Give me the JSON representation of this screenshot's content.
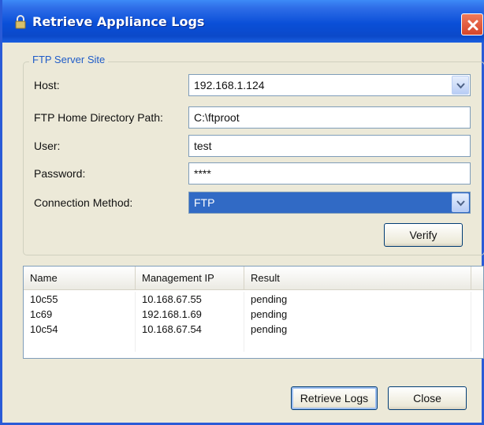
{
  "window": {
    "title": "Retrieve Appliance Logs",
    "icon": "lock-icon",
    "close_icon": "close-icon"
  },
  "ftp_group": {
    "legend": "FTP Server Site",
    "host_label": "Host:",
    "host_value": "192.168.1.124",
    "home_dir_label": "FTP Home Directory Path:",
    "home_dir_value": "C:\\ftproot",
    "user_label": "User:",
    "user_value": "test",
    "password_label": "Password:",
    "password_value": "****",
    "connection_label": "Connection Method:",
    "connection_value": "FTP",
    "verify_label": "Verify"
  },
  "table": {
    "columns": [
      "Name",
      "Management IP",
      "Result"
    ],
    "rows": [
      [
        "10c55",
        "10.168.67.55",
        "pending"
      ],
      [
        "1c69",
        "192.168.1.69",
        "pending"
      ],
      [
        "10c54",
        "10.168.67.54",
        "pending"
      ]
    ]
  },
  "footer": {
    "retrieve_label": "Retrieve Logs",
    "close_label": "Close"
  },
  "colors": {
    "titlebar": "#0a4fd8",
    "selection": "#316ac5",
    "legend": "#1f5cc8",
    "dialog_bg": "#ece9d8"
  }
}
